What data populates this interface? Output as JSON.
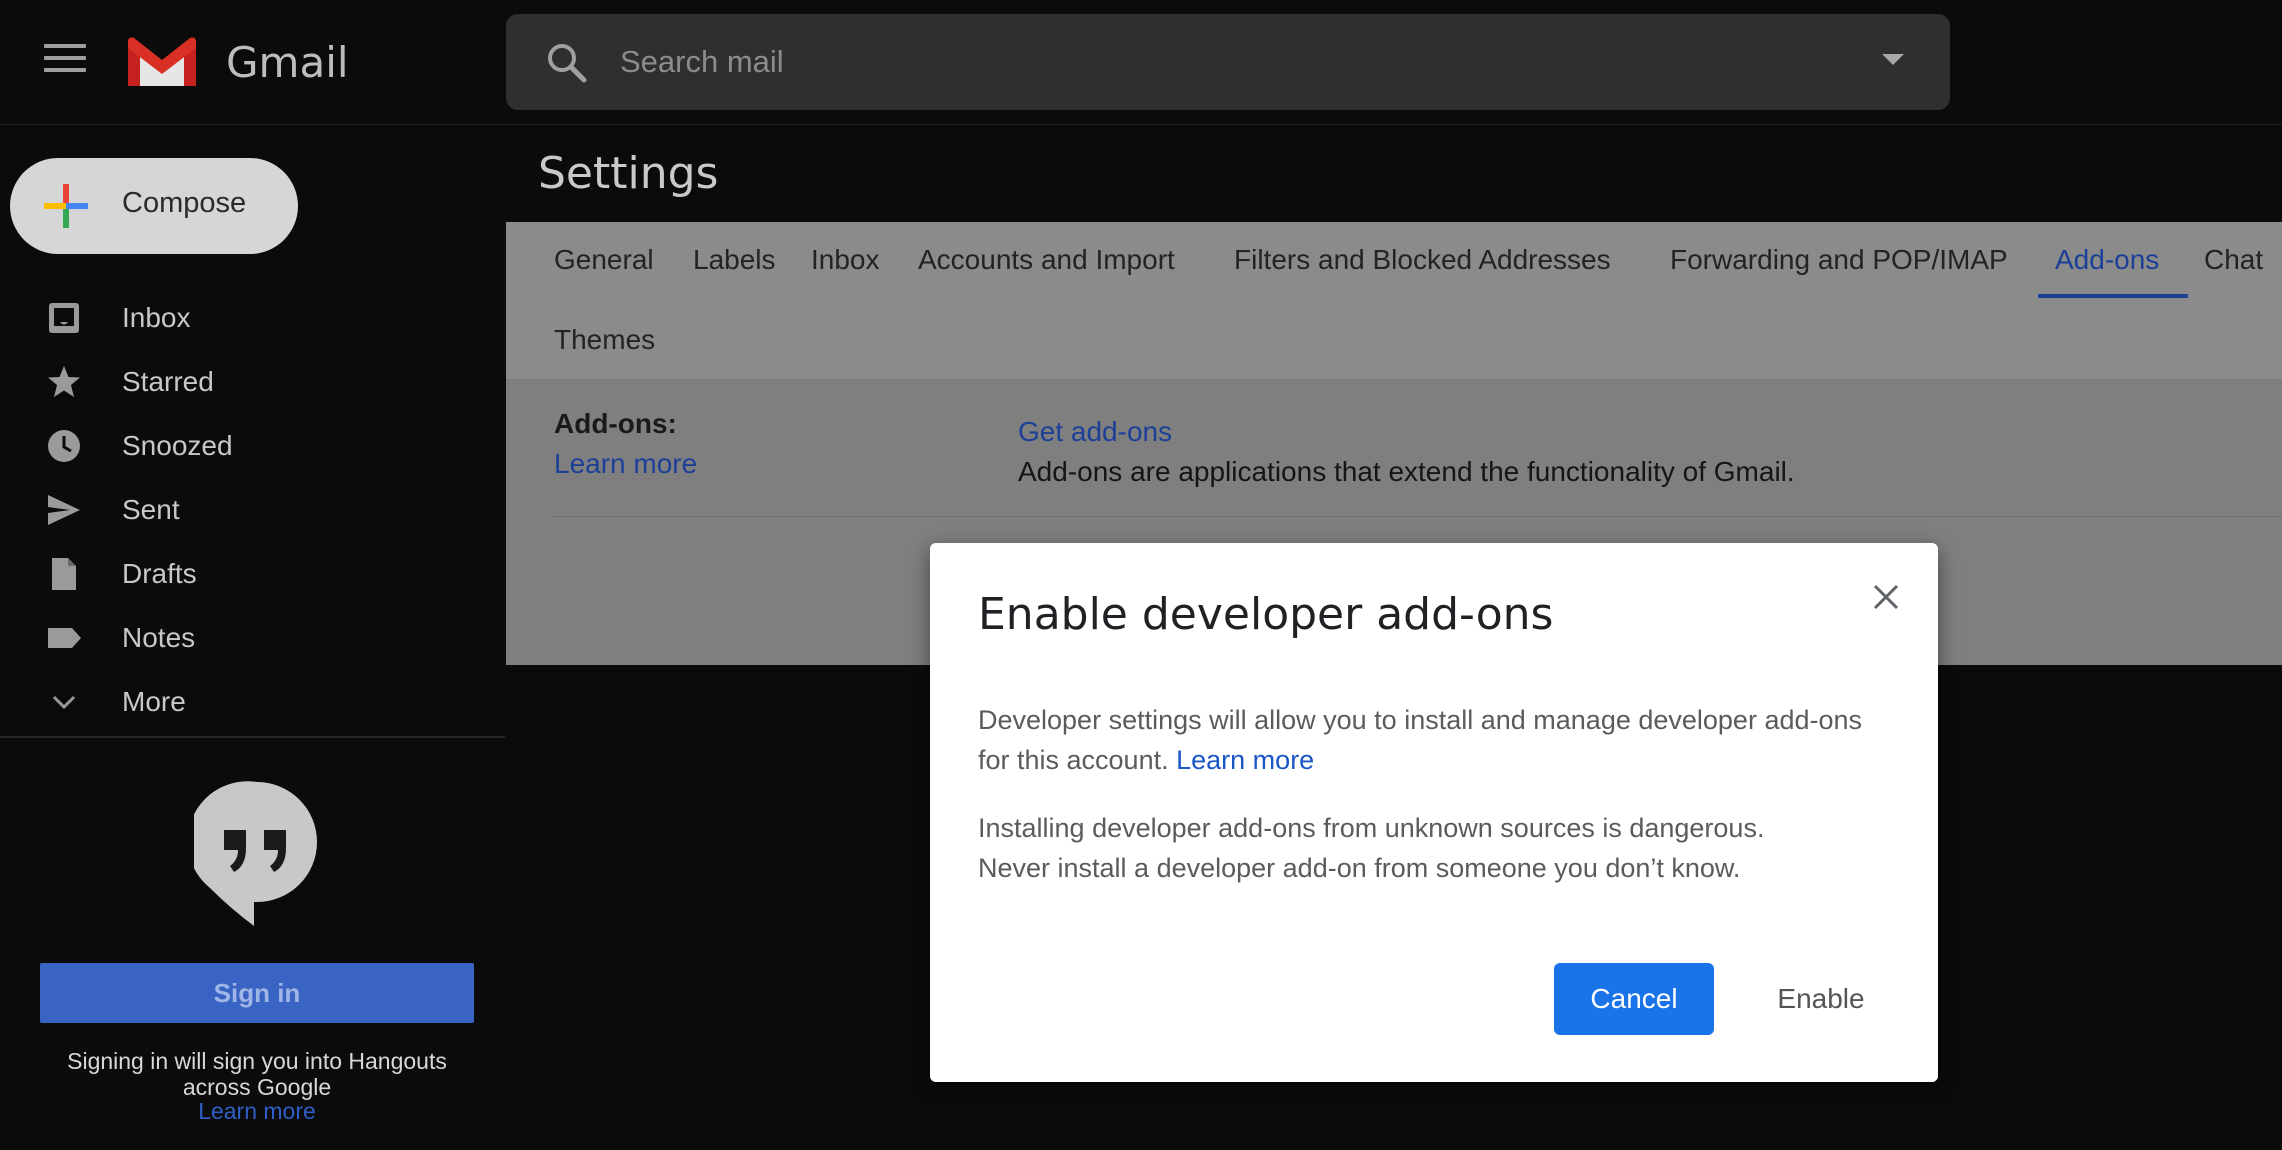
{
  "header": {
    "app_name": "Gmail",
    "search_placeholder": "Search mail"
  },
  "sidebar": {
    "compose_label": "Compose",
    "items": [
      {
        "label": "Inbox",
        "icon": "inbox-icon"
      },
      {
        "label": "Starred",
        "icon": "star-icon"
      },
      {
        "label": "Snoozed",
        "icon": "clock-icon"
      },
      {
        "label": "Sent",
        "icon": "send-icon"
      },
      {
        "label": "Drafts",
        "icon": "draft-icon"
      },
      {
        "label": "Notes",
        "icon": "label-icon"
      },
      {
        "label": "More",
        "icon": "chevron-down-icon"
      }
    ],
    "hangouts": {
      "signin_label": "Sign in",
      "note": "Signing in will sign you into Hangouts across Google",
      "learn_more": "Learn more"
    }
  },
  "settings": {
    "title": "Settings",
    "tabs": [
      "General",
      "Labels",
      "Inbox",
      "Accounts and Import",
      "Filters and Blocked Addresses",
      "Forwarding and POP/IMAP",
      "Add-ons",
      "Chat",
      "Themes"
    ],
    "active_tab": "Add-ons",
    "addons_row": {
      "label": "Add-ons:",
      "learn_more": "Learn more",
      "get_addons": "Get add-ons",
      "description": "Add-ons are applications that extend the functionality of Gmail."
    }
  },
  "dialog": {
    "title": "Enable developer add-ons",
    "paragraph1": "Developer settings will allow you to install and manage developer add-ons for this account.",
    "paragraph1_link": "Learn more",
    "paragraph2_line1": "Installing developer add-ons from unknown sources is dangerous.",
    "paragraph2_line2": "Never install a developer add-on from someone you don’t know.",
    "cancel_label": "Cancel",
    "enable_label": "Enable"
  },
  "colors": {
    "accent_blue": "#1a73e8",
    "link_blue": "#1a56c6",
    "background": "#0b0b0b"
  }
}
